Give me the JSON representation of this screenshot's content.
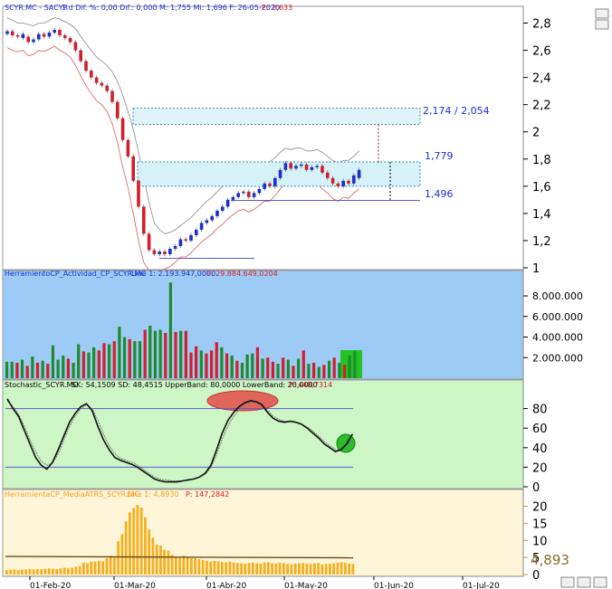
{
  "panes": {
    "price": {
      "title": "SCYR.MC - SACYR",
      "info": "1 d  Dif. %: 0,00  Dif.: 0,000  M: 1,755  Mi: 1,696  F: 26-05-2020",
      "p_label": "P.: 2,633",
      "yticks": [
        "2,8",
        "2,6",
        "2,4",
        "2,2",
        "2",
        "1,8",
        "1,6",
        "1,4",
        "1,2",
        "1"
      ],
      "levels": {
        "upper": "2,174 / 2,054",
        "mid": "1,779",
        "low": "1,496"
      }
    },
    "volume": {
      "title": "HerramientoCP_Actividad_CP_SCYR.MC",
      "line": "Line 1: 2.193.947,0000",
      "p_label": "P: 29.884.649,0204",
      "yticks": [
        "8.000.000",
        "6.000.000",
        "4.000.000",
        "2.000.000"
      ]
    },
    "stoch": {
      "title": "Stochastic_SCYR.MC",
      "info": "SK: 54,1509  SD: 48,4515  UpperBand: 80,0000  LowerBand: 20,0000",
      "p_label": "P: 448,7314",
      "yticks": [
        "80",
        "60",
        "40",
        "20",
        "0"
      ]
    },
    "atr": {
      "title": "HerramientaCP_MediaATRS_SCYR.MC",
      "line": "Line 1: 4,8930",
      "p_label": "P: 147,2842",
      "yticks": [
        "20",
        "15",
        "10",
        "5",
        "0"
      ],
      "current": "4,893"
    }
  },
  "xaxis": {
    "labels": [
      "01-Feb-20",
      "01-Mar-20",
      "01-Abr-20",
      "01-May-20",
      "01-Jun-20",
      "01-Jul-20"
    ]
  },
  "colors": {
    "up": "#1f8a2e",
    "down": "#d21f2a",
    "candle_up": "#1a2fd0",
    "candle_down": "#d21f2a",
    "volume_bg": "#9ecbf5",
    "stoch_bg": "#cdf5c6",
    "atr_bg": "#fff5d8",
    "atr_bar": "#f5b021",
    "level": "#1a2fd0"
  },
  "chart_data": [
    {
      "type": "candlestick",
      "title": "SCYR.MC - SACYR",
      "ylim": [
        1.0,
        2.85
      ],
      "close": [
        2.74,
        2.71,
        2.7,
        2.72,
        2.66,
        2.68,
        2.72,
        2.7,
        2.73,
        2.75,
        2.71,
        2.69,
        2.66,
        2.6,
        2.52,
        2.45,
        2.4,
        2.36,
        2.34,
        2.3,
        2.22,
        2.1,
        1.94,
        1.82,
        1.64,
        1.45,
        1.25,
        1.13,
        1.1,
        1.12,
        1.1,
        1.14,
        1.16,
        1.21,
        1.2,
        1.24,
        1.28,
        1.33,
        1.35,
        1.38,
        1.42,
        1.45,
        1.5,
        1.52,
        1.55,
        1.56,
        1.52,
        1.55,
        1.58,
        1.62,
        1.6,
        1.66,
        1.72,
        1.77,
        1.73,
        1.75,
        1.76,
        1.72,
        1.74,
        1.75,
        1.7,
        1.66,
        1.62,
        1.6,
        1.64,
        1.62,
        1.68,
        1.72
      ],
      "open": [
        2.72,
        2.74,
        2.71,
        2.69,
        2.7,
        2.66,
        2.68,
        2.72,
        2.7,
        2.73,
        2.75,
        2.71,
        2.69,
        2.66,
        2.6,
        2.52,
        2.45,
        2.4,
        2.36,
        2.34,
        2.3,
        2.22,
        2.1,
        1.94,
        1.82,
        1.64,
        1.45,
        1.25,
        1.13,
        1.1,
        1.12,
        1.1,
        1.14,
        1.16,
        1.21,
        1.2,
        1.24,
        1.28,
        1.33,
        1.35,
        1.38,
        1.42,
        1.45,
        1.5,
        1.52,
        1.55,
        1.56,
        1.52,
        1.55,
        1.58,
        1.62,
        1.6,
        1.66,
        1.72,
        1.77,
        1.73,
        1.75,
        1.76,
        1.72,
        1.74,
        1.75,
        1.7,
        1.66,
        1.62,
        1.6,
        1.64,
        1.62,
        1.66
      ],
      "upper_band": [
        2.84,
        2.82,
        2.8,
        2.8,
        2.79,
        2.78,
        2.8,
        2.8,
        2.82,
        2.84,
        2.83,
        2.81,
        2.79,
        2.76,
        2.7,
        2.65,
        2.6,
        2.55,
        2.52,
        2.49,
        2.44,
        2.37,
        2.27,
        2.15,
        2.02,
        1.85,
        1.66,
        1.48,
        1.33,
        1.28,
        1.25,
        1.26,
        1.28,
        1.31,
        1.34,
        1.37,
        1.41,
        1.45,
        1.49,
        1.52,
        1.56,
        1.6,
        1.64,
        1.67,
        1.7,
        1.72,
        1.71,
        1.72,
        1.74,
        1.77,
        1.78,
        1.81,
        1.85,
        1.88,
        1.87,
        1.88,
        1.88,
        1.86,
        1.86,
        1.87,
        1.85,
        1.82,
        1.79,
        1.77,
        1.79,
        1.79,
        1.82,
        1.86
      ],
      "lower_band": [
        2.62,
        2.6,
        2.59,
        2.6,
        2.56,
        2.57,
        2.6,
        2.59,
        2.61,
        2.63,
        2.6,
        2.58,
        2.55,
        2.49,
        2.41,
        2.34,
        2.28,
        2.23,
        2.2,
        2.15,
        2.06,
        1.92,
        1.74,
        1.59,
        1.4,
        1.2,
        1.04,
        0.98,
        0.96,
        0.98,
        0.99,
        1.01,
        1.04,
        1.08,
        1.08,
        1.11,
        1.15,
        1.19,
        1.22,
        1.25,
        1.29,
        1.32,
        1.36,
        1.39,
        1.42,
        1.43,
        1.41,
        1.43,
        1.46,
        1.49,
        1.49,
        1.53,
        1.58,
        1.62,
        1.61,
        1.62,
        1.63,
        1.6,
        1.61,
        1.62,
        1.58,
        1.55,
        1.51,
        1.49,
        1.52,
        1.51,
        1.55,
        1.58
      ],
      "levels": [
        2.174,
        2.054,
        1.779,
        1.6,
        1.496
      ]
    },
    {
      "type": "bar",
      "title": "HerramientoCP_Actividad_CP_SCYR.MC",
      "ylim": [
        0,
        9500000
      ],
      "values": [
        1600000,
        1600000,
        1500000,
        1800000,
        1200000,
        2100000,
        1500000,
        1700000,
        1400000,
        3200000,
        1800000,
        2200000,
        1900000,
        1500000,
        3300000,
        2600000,
        2500000,
        3000000,
        2700000,
        3400000,
        3300000,
        3600000,
        5000000,
        4000000,
        3800000,
        3600000,
        3600000,
        4700000,
        5100000,
        4600000,
        4700000,
        4400000,
        9300000,
        4500000,
        4600000,
        4600000,
        2500000,
        3100000,
        2700000,
        2400000,
        2700000,
        3500000,
        3000000,
        2400000,
        2200000,
        1700000,
        1500000,
        2300000,
        2400000,
        3000000,
        1900000,
        2000000,
        1600000,
        1400000,
        2000000,
        1800000,
        1200000,
        1900000,
        2700000,
        1400000,
        1500000,
        1100000,
        1300000,
        1700000,
        2000000,
        1500000,
        1300000,
        2200000,
        2600000
      ],
      "up": [
        true,
        true,
        false,
        true,
        false,
        true,
        false,
        true,
        false,
        true,
        true,
        true,
        false,
        true,
        true,
        false,
        true,
        true,
        false,
        false,
        true,
        false,
        true,
        true,
        false,
        true,
        true,
        false,
        true,
        true,
        true,
        false,
        true,
        false,
        true,
        false,
        false,
        false,
        true,
        false,
        false,
        false,
        true,
        false,
        true,
        false,
        true,
        true,
        true,
        false,
        true,
        false,
        false,
        true,
        false,
        true,
        false,
        true,
        false,
        true,
        false,
        true,
        false,
        true,
        false,
        true,
        false,
        true,
        true
      ]
    },
    {
      "type": "line",
      "title": "Stochastic_SCYR.MC",
      "ylim": [
        0,
        100
      ],
      "series": [
        {
          "name": "SK",
          "values": [
            90,
            80,
            72,
            58,
            44,
            30,
            22,
            18,
            25,
            38,
            52,
            66,
            75,
            82,
            85,
            78,
            62,
            48,
            38,
            30,
            27,
            25,
            23,
            20,
            16,
            12,
            8,
            6,
            5,
            5,
            5,
            6,
            7,
            8,
            10,
            14,
            22,
            38,
            55,
            68,
            76,
            82,
            86,
            88,
            87,
            84,
            76,
            70,
            67,
            66,
            67,
            66,
            64,
            60,
            55,
            50,
            44,
            40,
            36,
            38,
            44,
            54
          ]
        },
        {
          "name": "SD",
          "values": [
            88,
            82,
            74,
            62,
            48,
            36,
            26,
            22,
            24,
            34,
            48,
            62,
            72,
            80,
            84,
            80,
            68,
            54,
            42,
            34,
            29,
            27,
            25,
            22,
            18,
            14,
            10,
            8,
            7,
            6,
            6,
            6,
            7,
            8,
            10,
            13,
            20,
            33,
            49,
            62,
            72,
            79,
            84,
            86,
            86,
            84,
            78,
            72,
            69,
            67,
            67,
            66,
            64,
            61,
            57,
            52,
            46,
            42,
            38,
            38,
            42,
            48
          ]
        }
      ],
      "upper_band": 80,
      "lower_band": 20
    },
    {
      "type": "bar",
      "title": "HerramientaCP_MediaATRS_SCYR.MC",
      "ylim": [
        0,
        22
      ],
      "values": [
        1.3,
        1.4,
        1.5,
        1.3,
        1.4,
        1.5,
        1.6,
        1.5,
        1.6,
        1.6,
        1.7,
        1.8,
        1.7,
        1.6,
        1.8,
        2.0,
        1.8,
        2.0,
        2.3,
        2.5,
        3.5,
        3.3,
        3.8,
        3.8,
        4.0,
        3.9,
        4.8,
        5.5,
        5.0,
        9.8,
        11.8,
        15.6,
        18.2,
        19.5,
        20.4,
        19.6,
        16.8,
        13.2,
        10.8,
        8.8,
        8.5,
        7.2,
        7.0,
        5.8,
        5.2,
        5.0,
        5.5,
        5.0,
        4.8,
        4.8,
        4.5,
        4.2,
        4.0,
        3.8,
        4.0,
        3.9,
        3.7,
        3.6,
        3.8,
        3.5,
        3.4,
        3.3,
        3.2,
        3.4,
        3.5,
        3.3,
        3.2,
        3.5,
        3.6,
        3.3,
        3.2,
        3.4,
        3.3,
        3.1,
        3.0,
        3.2,
        3.3,
        3.4,
        3.2,
        3.1,
        3.3,
        3.4,
        3.0,
        3.1,
        3.2,
        3.3,
        3.5,
        3.6,
        3.4,
        3.2,
        3.1
      ],
      "line": 4.893
    }
  ]
}
